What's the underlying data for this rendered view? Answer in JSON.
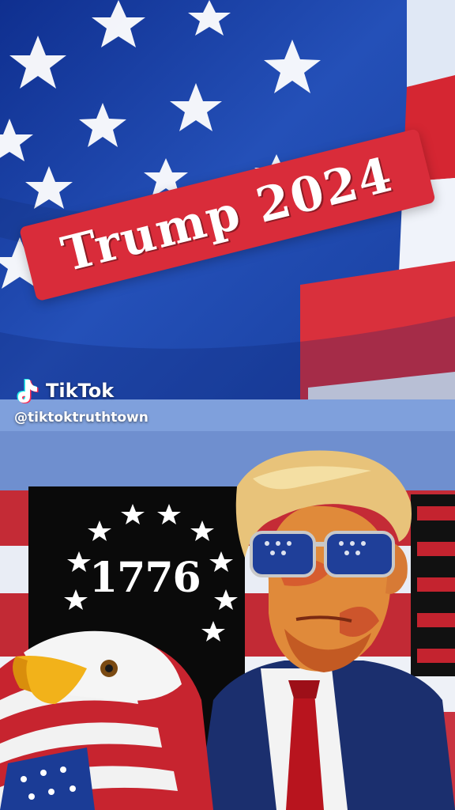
{
  "banner": {
    "text": "Trump 2024"
  },
  "tiktok": {
    "brand": "TikTok",
    "handle": "@tiktoktruthtown"
  },
  "artwork": {
    "year": "1776"
  },
  "colors": {
    "flag_blue": "#1a3c9a",
    "flag_red": "#d92c3a",
    "banner_red": "#d92c3a",
    "white": "#ffffff"
  },
  "icons": {
    "tiktok_logo": "tiktok-note-icon"
  }
}
